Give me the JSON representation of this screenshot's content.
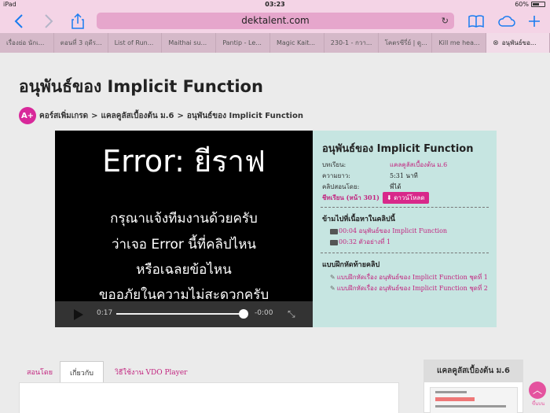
{
  "status": {
    "device": "iPad",
    "time": "03:23",
    "battery": "60%",
    "battery_level": 0.6
  },
  "browser": {
    "url": "dektalent.com",
    "tabs": [
      {
        "label": "เรื่องย่อ นักเ..."
      },
      {
        "label": "ตอนที่ 3 ฤดีร..."
      },
      {
        "label": "List of Run..."
      },
      {
        "label": "Maithai su..."
      },
      {
        "label": "Pantip - Le..."
      },
      {
        "label": "Magic Kait..."
      },
      {
        "label": "230-1 - กวา..."
      },
      {
        "label": "โคตรซีรี่ย์ | ดู..."
      },
      {
        "label": "Kill me hea..."
      },
      {
        "label": "อนุพันธ์ขอ..."
      }
    ]
  },
  "page": {
    "title": "อนุพันธ์ของ Implicit Function",
    "logo_text": "A+",
    "breadcrumb": [
      "คอร์สเพิ่มเกรด",
      "แคลคูลัสเบื้องต้น ม.6",
      "อนุพันธ์ของ Implicit Function"
    ],
    "breadcrumb_sep": ">"
  },
  "video": {
    "error_title": "Error: ยีราฟ",
    "lines": [
      "กรุณาแจ้งทีมงานด้วยครับ",
      "ว่าเจอ Error นี้ที่คลิปไหน",
      "หรือเฉลยข้อไหน",
      "ขออภัยในความไม่สะดวกครับ"
    ],
    "current_time": "0:17",
    "remaining_time": "-0:00",
    "progress": 0.98
  },
  "info": {
    "title": "อนุพันธ์ของ Implicit Function",
    "lesson_label": "บทเรียน:",
    "lesson_value": "แคลคูลัสเบื้องต้น ม.6",
    "length_label": "ความยาว:",
    "length_value": "5:31 นาที",
    "teacher_label": "คลิปสอนโดย:",
    "teacher_value": "พี่ได้",
    "sheet_label": "ชีทเรียน (หน้า 301)",
    "download_label": "⬇ ดาวน์โหลด",
    "jump_heading": "ข้ามไปที่เนื้อหาในคลิปนี้",
    "jump_items": [
      "00:04 อนุพันธ์ของ Implicit Function",
      "00:32 ตัวอย่างที่ 1"
    ],
    "exercise_heading": "แบบฝึกหัดท้ายคลิป",
    "exercise_items": [
      "แบบฝึกหัดเรื่อง อนุพันธ์ของ Implicit Function ชุดที่ 1",
      "แบบฝึกหัดเรื่อง อนุพันธ์ของ Implicit Function ชุดที่ 2"
    ]
  },
  "bottom_tabs": {
    "teacher": "สอนโดย",
    "about": "เกี่ยวกับ",
    "howto": "วิธีใช้งาน VDO Player"
  },
  "sidebar": {
    "title": "แคลคูลัสเบื้องต้น ม.6"
  },
  "to_top": {
    "label": "ขึ้นบน"
  },
  "colors": {
    "accent": "#c2247f",
    "browser_chrome": "#f4d4e6",
    "info_panel": "#c6e5e1"
  }
}
